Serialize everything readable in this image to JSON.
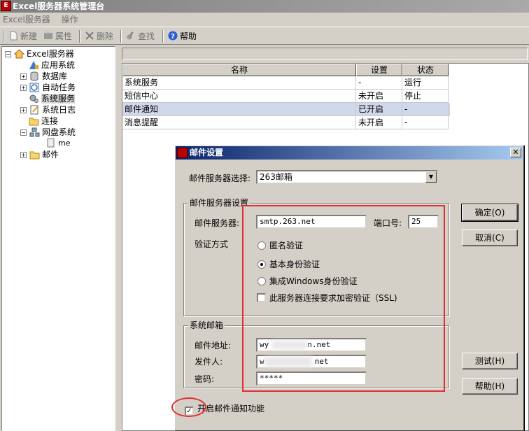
{
  "window": {
    "title": "Excel服务器系统管理台",
    "icon": "app-logo-icon"
  },
  "menu": [
    "Excel服务器",
    "操作"
  ],
  "toolbar": {
    "new_label": "新建",
    "props_label": "属性",
    "delete_label": "删除",
    "find_label": "查找",
    "help_label": "帮助"
  },
  "tree": {
    "root": "Excel服务器",
    "items": [
      {
        "label": "应用系统",
        "icon": "app-system-icon"
      },
      {
        "label": "数据库",
        "icon": "database-icon"
      },
      {
        "label": "自动任务",
        "icon": "auto-task-icon"
      },
      {
        "label": "系统服务",
        "icon": "system-service-icon"
      },
      {
        "label": "系统日志",
        "icon": "system-log-icon"
      },
      {
        "label": "连接",
        "icon": "connection-folder-icon"
      },
      {
        "label": "网盘系统",
        "icon": "netdisk-icon"
      },
      {
        "label": "me",
        "icon": "file-icon"
      },
      {
        "label": "邮件",
        "icon": "mail-folder-icon"
      }
    ]
  },
  "list": {
    "columns": [
      "名称",
      "设置",
      "状态"
    ],
    "rows": [
      [
        "系统服务",
        "-",
        "运行"
      ],
      [
        "短信中心",
        "未开启",
        "停止"
      ],
      [
        "邮件通知",
        "已开启",
        "-"
      ],
      [
        "消息提醒",
        "未开启",
        "-"
      ]
    ]
  },
  "dialog": {
    "title": "邮件设置",
    "server_select_label": "邮件服务器选择:",
    "server_select_value": "263邮箱",
    "server_group_title": "邮件服务器设置",
    "mail_server_label": "邮件服务器:",
    "mail_server_value": "smtp.263.net",
    "port_label": "端口号:",
    "port_value": "25",
    "auth_label": "验证方式",
    "auth_options": [
      "匿名验证",
      "基本身份验证",
      "集成Windows身份验证"
    ],
    "auth_selected": "基本身份验证",
    "ssl_label": "此服务器连接要求加密验证（SSL)",
    "mailbox_group_title": "系统邮箱",
    "address_label": "邮件地址:",
    "address_value_start": "wy",
    "address_value_end": "n.net",
    "sender_label": "发件人:",
    "sender_value_start": "w",
    "sender_value_end": "net",
    "password_label": "密码:",
    "password_value": "*****",
    "enable_label": "开启邮件通知功能",
    "enable_checked": true,
    "ok_label": "确定(O)",
    "cancel_label": "取消(C)",
    "test_label": "测试(H)",
    "help_label": "帮助(H)"
  },
  "colors": {
    "highlight": "#e03030",
    "selected_row": "#d0d8ec",
    "dialog_title": "#0a246a"
  }
}
